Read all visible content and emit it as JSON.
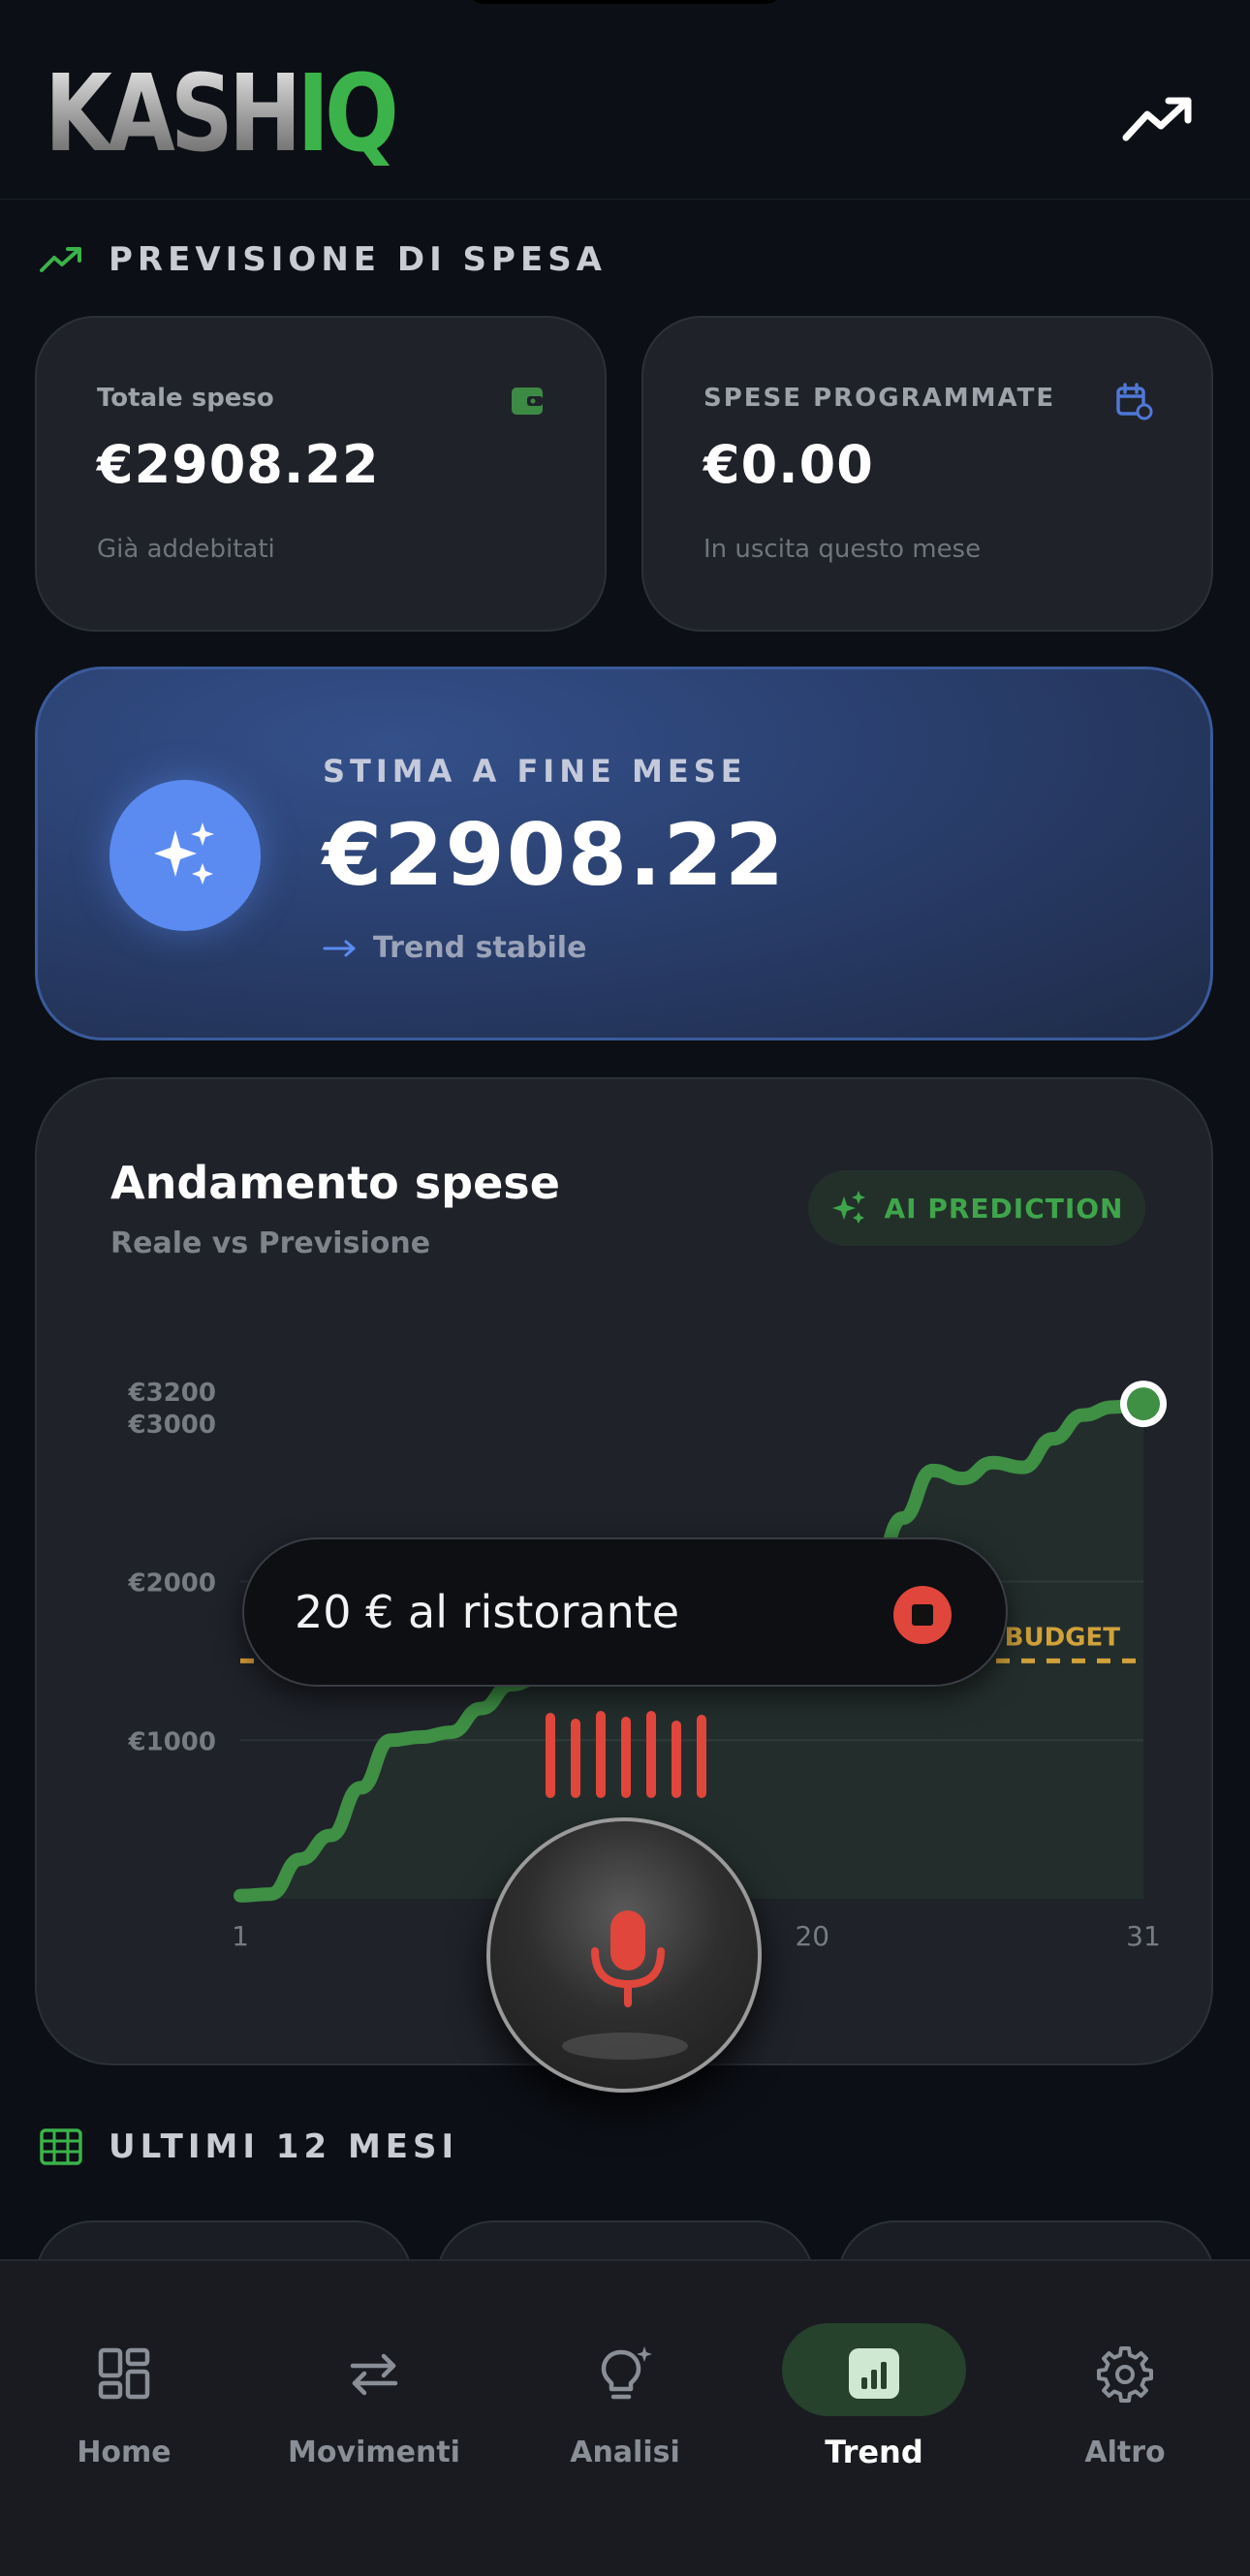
{
  "app": {
    "logo_part1": "KASH",
    "logo_part2": "IQ",
    "brand_green": "#3bb34a"
  },
  "forecast_section": {
    "title": "PREVISIONE DI SPESA",
    "total_card": {
      "label": "Totale speso",
      "value": "€2908.22",
      "sub": "Già addebitati"
    },
    "scheduled_card": {
      "label": "SPESE PROGRAMMATE",
      "value": "€0.00",
      "sub": "In uscita questo mese"
    },
    "estimate_card": {
      "label": "STIMA A FINE MESE",
      "value": "€2908.22",
      "trend": "Trend stabile"
    }
  },
  "chart": {
    "title": "Andamento spese",
    "subtitle": "Reale vs Previsione",
    "ai_badge": "AI PREDICTION",
    "budget_label": "BUDGET"
  },
  "chart_data": {
    "type": "area",
    "title": "Andamento spese",
    "subtitle": "Reale vs Previsione",
    "xlabel": "",
    "ylabel": "",
    "x_ticks": [
      "1",
      "20",
      "31"
    ],
    "y_ticks": [
      "€1000",
      "€2000",
      "€3000",
      "€3200"
    ],
    "xlim": [
      1,
      31
    ],
    "ylim": [
      0,
      3200
    ],
    "budget": 1500,
    "series": [
      {
        "color": "#3f8f45",
        "x": [
          1,
          2,
          3,
          4,
          5,
          6,
          7,
          8,
          9,
          10,
          11,
          12,
          13,
          14,
          15,
          16,
          17,
          18,
          19,
          20,
          21,
          22,
          23,
          24,
          25,
          26,
          27,
          28,
          29,
          30,
          31
        ],
        "y": [
          20,
          30,
          250,
          400,
          700,
          1000,
          1020,
          1050,
          1200,
          1350,
          1400,
          1450,
          1480,
          1500,
          1550,
          1700,
          1750,
          1780,
          1820,
          1860,
          1900,
          2000,
          2400,
          2700,
          2650,
          2750,
          2720,
          2900,
          3050,
          3100,
          3120
        ]
      }
    ],
    "grid": true,
    "legend": "none"
  },
  "voice": {
    "text": "20 € al ristorante",
    "accent": "#e0463b"
  },
  "history_section": {
    "title": "ULTIMI 12 MESI"
  },
  "nav": {
    "items": [
      {
        "label": "Home"
      },
      {
        "label": "Movimenti"
      },
      {
        "label": "Analisi"
      },
      {
        "label": "Trend"
      },
      {
        "label": "Altro"
      }
    ],
    "active": "Trend"
  }
}
